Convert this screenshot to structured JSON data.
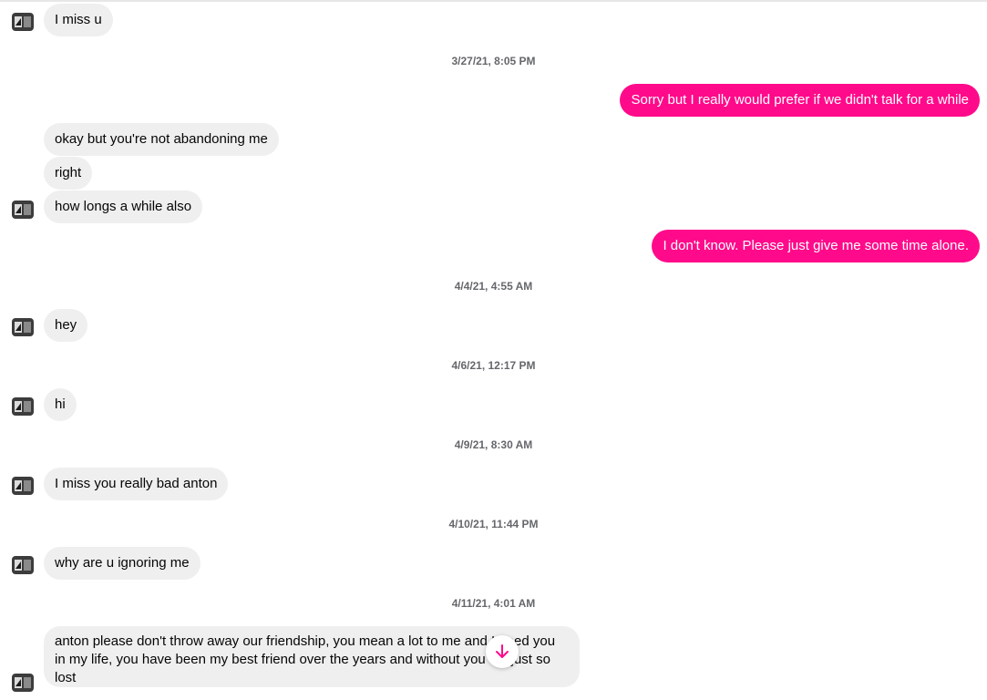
{
  "conversation": {
    "messages": [
      {
        "from": "them",
        "text": "I miss u"
      },
      {
        "timestamp": "3/27/21, 8:05 PM"
      },
      {
        "from": "me",
        "text": "Sorry but I really would prefer if we didn't talk for a while"
      },
      {
        "from": "them",
        "text": "okay but you're not abandoning me"
      },
      {
        "from": "them",
        "text": "right"
      },
      {
        "from": "them",
        "text": "how longs a while also"
      },
      {
        "from": "me",
        "text": "I don't know. Please just give me some time alone."
      },
      {
        "timestamp": "4/4/21, 4:55 AM"
      },
      {
        "from": "them",
        "text": "hey"
      },
      {
        "timestamp": "4/6/21, 12:17 PM"
      },
      {
        "from": "them",
        "text": "hi"
      },
      {
        "timestamp": "4/9/21, 8:30 AM"
      },
      {
        "from": "them",
        "text": "I miss you really bad anton"
      },
      {
        "timestamp": "4/10/21, 11:44 PM"
      },
      {
        "from": "them",
        "text": "why are u ignoring me"
      },
      {
        "timestamp": "4/11/21, 4:01 AM"
      },
      {
        "from": "them",
        "text": "anton please don't throw away our friendship, you mean a lot to me and I need you in my life, you have been my best friend over the years and without you I'm just so lost"
      }
    ]
  },
  "colors": {
    "sent_bubble": "#ff0a8a",
    "received_bubble": "#efefef",
    "timestamp_text": "#65676b",
    "scroll_arrow": "#ff0a8a"
  },
  "icons": {
    "avatar": "contact-avatar",
    "scroll": "arrow-down-icon"
  }
}
